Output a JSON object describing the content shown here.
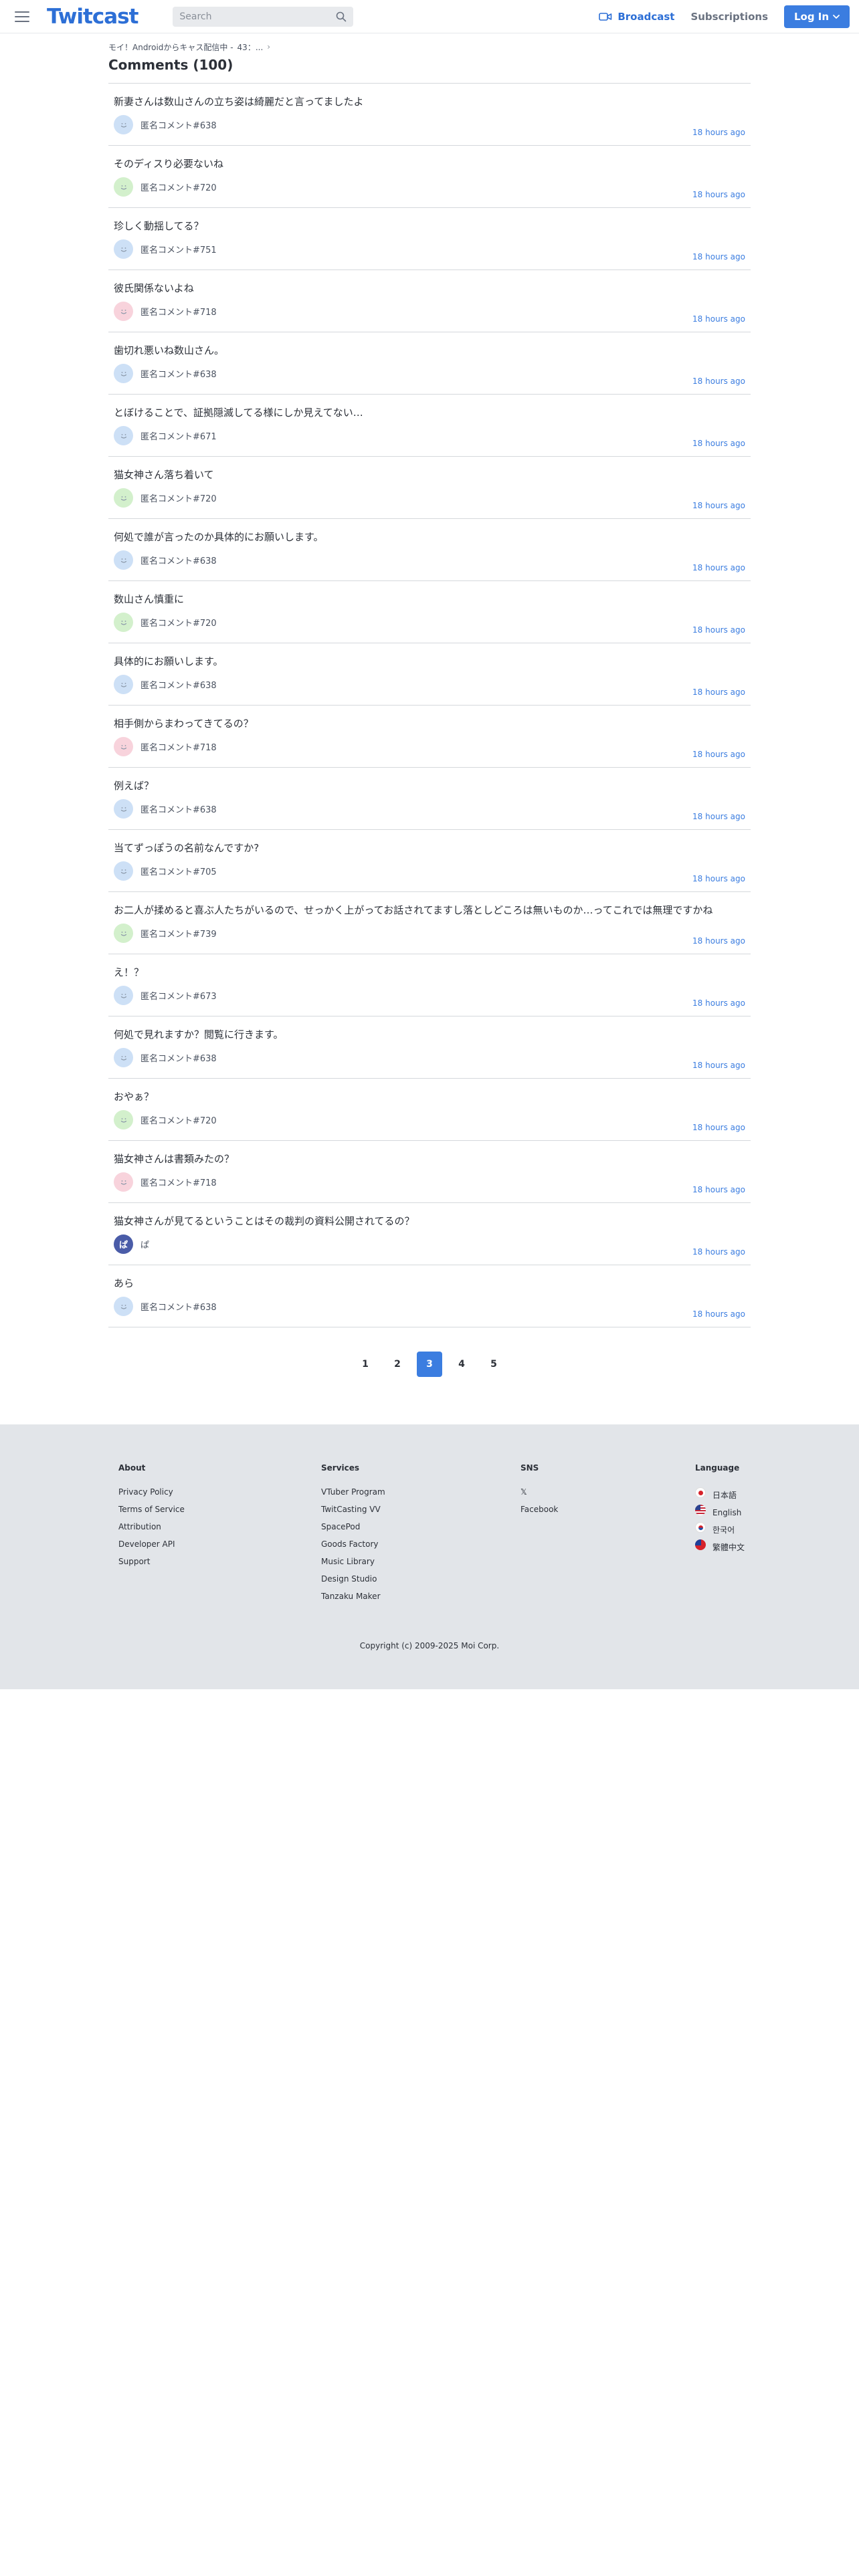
{
  "header": {
    "logo": "Twitcast",
    "search_placeholder": "Search",
    "broadcast_label": "Broadcast",
    "subscriptions_label": "Subscriptions",
    "login_label": "Log In"
  },
  "breadcrumb": [
    "モイ！Androidからキャス配信中 -",
    "43：..."
  ],
  "page_title": "Comments (100)",
  "comments": [
    {
      "text": "新妻さんは数山さんの立ち姿は綺麗だと言ってましたよ",
      "user": "匿名コメント#638",
      "avatar": "blue",
      "time": "18 hours ago"
    },
    {
      "text": "そのディスり必要ないね",
      "user": "匿名コメント#720",
      "avatar": "green",
      "time": "18 hours ago"
    },
    {
      "text": "珍しく動揺してる？",
      "user": "匿名コメント#751",
      "avatar": "blue",
      "time": "18 hours ago"
    },
    {
      "text": "彼氏関係ないよね",
      "user": "匿名コメント#718",
      "avatar": "pink",
      "time": "18 hours ago"
    },
    {
      "text": "歯切れ悪いね数山さん。",
      "user": "匿名コメント#638",
      "avatar": "blue",
      "time": "18 hours ago"
    },
    {
      "text": "とぼけることで、証拠隠滅してる様にしか見えてない…",
      "user": "匿名コメント#671",
      "avatar": "blue",
      "time": "18 hours ago"
    },
    {
      "text": "猫女神さん落ち着いて",
      "user": "匿名コメント#720",
      "avatar": "green",
      "time": "18 hours ago"
    },
    {
      "text": "何処で誰が言ったのか具体的にお願いします。",
      "user": "匿名コメント#638",
      "avatar": "blue",
      "time": "18 hours ago"
    },
    {
      "text": "数山さん慎重に",
      "user": "匿名コメント#720",
      "avatar": "green",
      "time": "18 hours ago"
    },
    {
      "text": "具体的にお願いします。",
      "user": "匿名コメント#638",
      "avatar": "blue",
      "time": "18 hours ago"
    },
    {
      "text": "相手側からまわってきてるの？",
      "user": "匿名コメント#718",
      "avatar": "pink",
      "time": "18 hours ago"
    },
    {
      "text": "例えば？",
      "user": "匿名コメント#638",
      "avatar": "blue",
      "time": "18 hours ago"
    },
    {
      "text": "当てずっぽうの名前なんですか?",
      "user": "匿名コメント#705",
      "avatar": "blue",
      "time": "18 hours ago"
    },
    {
      "text": "お二人が揉めると喜ぶ人たちがいるので、せっかく上がってお話されてますし落としどころは無いものか…ってこれでは無理ですかね",
      "user": "匿名コメント#739",
      "avatar": "green",
      "time": "18 hours ago"
    },
    {
      "text": "え！？",
      "user": "匿名コメント#673",
      "avatar": "blue",
      "time": "18 hours ago"
    },
    {
      "text": "何処で見れますか？閲覧に行きます。",
      "user": "匿名コメント#638",
      "avatar": "blue",
      "time": "18 hours ago"
    },
    {
      "text": "おやぁ？",
      "user": "匿名コメント#720",
      "avatar": "green",
      "time": "18 hours ago"
    },
    {
      "text": "猫女神さんは書類みたの？",
      "user": "匿名コメント#718",
      "avatar": "pink",
      "time": "18 hours ago"
    },
    {
      "text": "猫女神さんが見てるということはその裁判の資料公開されてるの？",
      "user": "ぱ",
      "avatar": "initial",
      "avatar_text": "ぱ",
      "time": "18 hours ago"
    },
    {
      "text": "あら",
      "user": "匿名コメント#638",
      "avatar": "blue",
      "time": "18 hours ago"
    }
  ],
  "pagination": {
    "pages": [
      "1",
      "2",
      "3",
      "4",
      "5"
    ],
    "current": "3"
  },
  "footer": {
    "columns": [
      {
        "title": "About",
        "links": [
          "Privacy Policy",
          "Terms of Service",
          "Attribution",
          "Developer API",
          "Support"
        ]
      },
      {
        "title": "Services",
        "links": [
          "VTuber Program",
          "TwitCasting VV",
          "SpacePod",
          "Goods Factory",
          "Music Library",
          "Design Studio",
          "Tanzaku Maker"
        ]
      },
      {
        "title": "SNS",
        "links": [
          "𝕏",
          "Facebook"
        ]
      },
      {
        "title": "Language",
        "links": [
          "日本語",
          "English",
          "한국어",
          "繁體中文"
        ],
        "flags": [
          "jp",
          "us",
          "kr",
          "tw"
        ]
      }
    ],
    "copyright": "Copyright (c) 2009-2025 Moi Corp."
  },
  "colors": {
    "accent": "#3b7de0",
    "logo": "#2d6fd6",
    "footer_bg": "#e2e5e9"
  }
}
